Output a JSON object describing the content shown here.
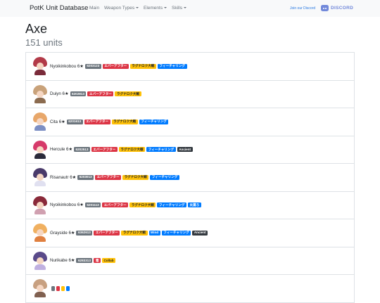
{
  "navbar": {
    "brand": "PotK Unit Database",
    "links": [
      "Main",
      "Weapon Types",
      "Elements",
      "Skills"
    ],
    "join_text": "Join our Discord",
    "discord_label": "DISCORD"
  },
  "page": {
    "title": "Axe",
    "count": "151 units"
  },
  "colors": {
    "navbar_bg": "#f8f9fa",
    "discord": "#7289da",
    "red": "#dc3545",
    "yellow": "#ffc107",
    "blue": "#007bff",
    "dark": "#343a40",
    "gray": "#6c757d"
  },
  "units": [
    {
      "name": "Nyoikinkobou 6★",
      "hair": "#b23a48",
      "outfit": "#7a2b3a",
      "badges": [
        {
          "text": "6203123",
          "style": "id"
        },
        {
          "text": "エバーアフター",
          "style": "red"
        },
        {
          "text": "ラグナロク大戦",
          "style": "yellow"
        },
        {
          "text": "フィーチャリング",
          "style": "blue"
        }
      ]
    },
    {
      "name": "Duiyn 6★",
      "hair": "#c9a27a",
      "outfit": "#8b6b4f",
      "badges": [
        {
          "text": "6202813",
          "style": "id"
        },
        {
          "text": "エバーアフター",
          "style": "red"
        },
        {
          "text": "ラグナロク大戦",
          "style": "yellow"
        }
      ]
    },
    {
      "name": "Cita 6★",
      "hair": "#e8a76a",
      "outfit": "#7c8fc4",
      "badges": [
        {
          "text": "6201613",
          "style": "id"
        },
        {
          "text": "エバーアフター",
          "style": "red"
        },
        {
          "text": "ラグナロク大戦",
          "style": "yellow"
        },
        {
          "text": "フィーチャリング",
          "style": "blue"
        }
      ]
    },
    {
      "name": "Hercule 6★",
      "hair": "#d63a6a",
      "outfit": "#2a2a3a",
      "badges": [
        {
          "text": "6202513",
          "style": "id"
        },
        {
          "text": "エバーアフター",
          "style": "red"
        },
        {
          "text": "ラグナロク大戦",
          "style": "yellow"
        },
        {
          "text": "フィーチャリング",
          "style": "blue"
        },
        {
          "text": "Ancient",
          "style": "dark"
        }
      ]
    },
    {
      "name": "Risanautr 6★",
      "hair": "#4a3a6a",
      "outfit": "#e0e0f0",
      "badges": [
        {
          "text": "6203013",
          "style": "id"
        },
        {
          "text": "エバーアフター",
          "style": "red"
        },
        {
          "text": "ラグナロク大戦",
          "style": "yellow"
        },
        {
          "text": "フィーチャリング",
          "style": "blue"
        }
      ]
    },
    {
      "name": "Nyoikinkobou 6★",
      "hair": "#8a2a3a",
      "outfit": "#d0a0b0",
      "badges": [
        {
          "text": "6201113",
          "style": "id"
        },
        {
          "text": "エバーアフター",
          "style": "red"
        },
        {
          "text": "ラグナロク大戦",
          "style": "yellow"
        },
        {
          "text": "フィーチャリング",
          "style": "blue"
        },
        {
          "text": "炎属ろ",
          "style": "blue"
        }
      ]
    },
    {
      "name": "Grayside 6★",
      "hair": "#f0b060",
      "outfit": "#e08040",
      "badges": [
        {
          "text": "6362613",
          "style": "id"
        },
        {
          "text": "エバーアフター",
          "style": "red"
        },
        {
          "text": "ラグナロク大戦",
          "style": "yellow"
        },
        {
          "text": "Wind",
          "style": "blue"
        },
        {
          "text": "フィーチャリング",
          "style": "blue"
        },
        {
          "text": "Ancient",
          "style": "dark"
        }
      ]
    },
    {
      "name": "Nurikabe 6★",
      "hair": "#5a4a8a",
      "outfit": "#c0b0e0",
      "badges": [
        {
          "text": "6283313",
          "style": "id"
        },
        {
          "text": "毒",
          "style": "red"
        },
        {
          "text": "Collab",
          "style": "yellow"
        }
      ]
    },
    {
      "name": "",
      "hair": "#c8a080",
      "outfit": "#806050",
      "badges": [
        {
          "text": "",
          "style": "id"
        },
        {
          "text": "",
          "style": "red"
        },
        {
          "text": "",
          "style": "yellow"
        },
        {
          "text": "",
          "style": "blue"
        }
      ]
    }
  ]
}
